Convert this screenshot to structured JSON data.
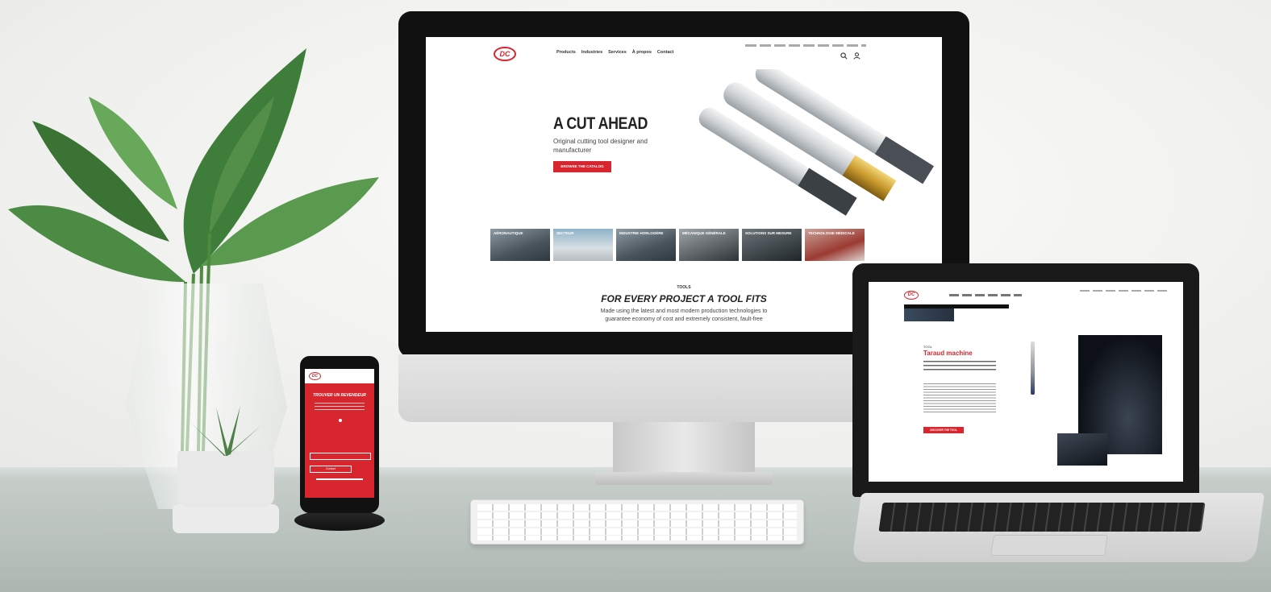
{
  "desktop_site": {
    "logo": "DC",
    "nav": [
      "Products",
      "Industries",
      "Services",
      "À propos",
      "Contact"
    ],
    "hero": {
      "title": "A CUT AHEAD",
      "subtitle": "Original cutting tool designer and manufacturer",
      "cta": "BROWSE THE CATALOG"
    },
    "categories": [
      "AÉRONAUTIQUE",
      "SECTEUR",
      "INDUSTRIE HORLOGÈRE",
      "MÉCANIQUE GÉNÉRALE",
      "SOLUTIONS SUR MESURE",
      "TECHNOLOGIE MÉDICALE"
    ],
    "section_eyebrow": "TOOLS",
    "section_title": "FOR EVERY PROJECT A TOOL FITS",
    "section_text": "Made using the latest and most modern production technologies to guarantee economy of cost and extremely consistent, fault-free"
  },
  "laptop_site": {
    "logo": "DC",
    "eyebrow": "TOOL",
    "heading": "Taraud machine",
    "cta": "DISCOVER THE TOOL"
  },
  "phone_site": {
    "logo": "DC",
    "title": "TROUVER UN REVENDEUR",
    "cta": "Contact"
  },
  "colors": {
    "brand_red": "#d8262e",
    "screen_black": "#111111",
    "desk": "#bfc7c3",
    "wall": "#f3f3f1"
  }
}
